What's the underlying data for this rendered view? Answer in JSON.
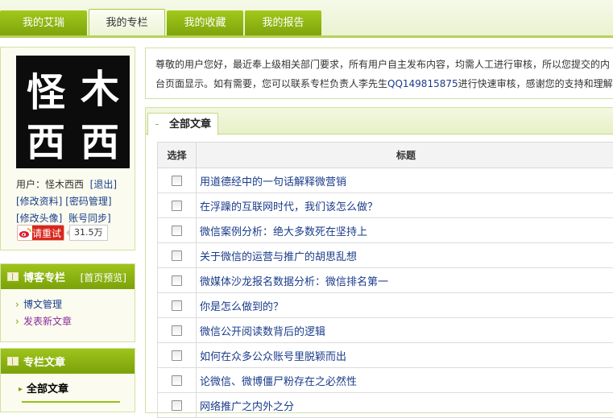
{
  "nav": {
    "tabs": [
      {
        "label": "我的艾瑞"
      },
      {
        "label": "我的专栏"
      },
      {
        "label": "我的收藏"
      },
      {
        "label": "我的报告"
      }
    ],
    "active_index": 1
  },
  "profile": {
    "avatar_text": [
      "怪",
      "木",
      "西",
      "西"
    ],
    "user_label": "用户：",
    "user_name": "怪木西西",
    "logout": "[退出]",
    "edit_profile": "[修改资料]",
    "change_password": "[密码管理]",
    "edit_avatar": "[修改头像]",
    "account_sync": "账号同步]",
    "weibo_label": "请重试",
    "weibo_count": "31.5万"
  },
  "blog_section": {
    "title": "博客专栏",
    "preview": "[首页预览]",
    "items": [
      {
        "label": "博文管理"
      },
      {
        "label": "发表新文章"
      }
    ]
  },
  "column_section": {
    "title": "专栏文章",
    "items": [
      {
        "label": "全部文章"
      }
    ]
  },
  "notice": {
    "line1": "尊敬的用户您好，最近奉上级相关部门要求，所有用户自主发布内容，均需人工进行审核，所以您提交的内",
    "line2_pre": "台页面显示。如有需要，您可以联系专栏负责人李先生",
    "qq": "QQ149815875",
    "line2_post": "进行快速审核，感谢您的支持和理解:"
  },
  "articles": {
    "tab_label": "全部文章",
    "columns": {
      "select": "选择",
      "title": "标题"
    },
    "rows": [
      {
        "title": "用道德经中的一句话解释微营销"
      },
      {
        "title": "在浮躁的互联网时代，我们该怎么做？"
      },
      {
        "title": "微信案例分析：绝大多数死在坚持上"
      },
      {
        "title": "关于微信的运营与推广的胡思乱想"
      },
      {
        "title": "微媒体沙龙报名数据分析：微信排名第一"
      },
      {
        "title": "你是怎么做到的？"
      },
      {
        "title": "微信公开阅读数背后的逻辑"
      },
      {
        "title": "如何在众多公众账号里脱颖而出"
      },
      {
        "title": "论微信、微博僵尸粉存在之必然性"
      },
      {
        "title": "网络推广之内外之分"
      }
    ]
  },
  "colors": {
    "accent_green": "#8db414",
    "link_blue": "#1a3c8a",
    "weibo_red": "#d9261c"
  }
}
